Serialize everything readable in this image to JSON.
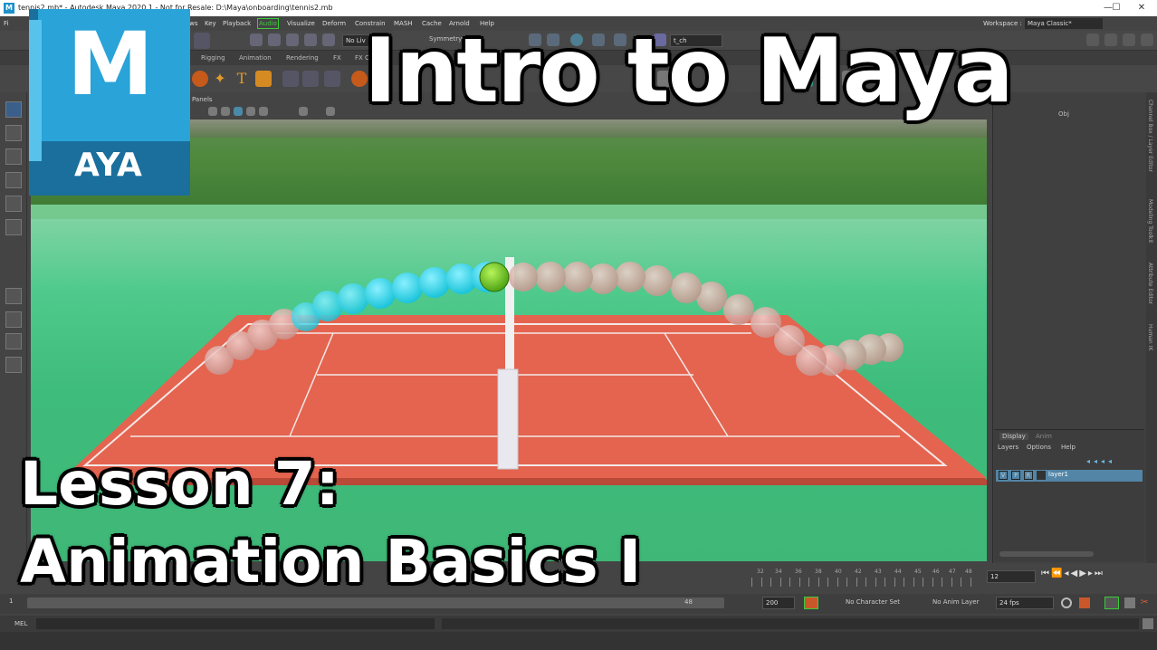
{
  "window": {
    "title": "tennis2.mb* - Autodesk Maya 2020.1 - Not for Resale: D:\\Maya\\onboarding\\tennis2.mb",
    "workspace_label": "Workspace :",
    "workspace_value": "Maya Classic*"
  },
  "menubar": {
    "items": [
      "Fi",
      "ndows",
      "Key",
      "Playback",
      "Audio",
      "Visualize",
      "Deform",
      "Constrain",
      "MASH",
      "Cache",
      "Arnold",
      "Help"
    ]
  },
  "statusline": {
    "no_live": "No Liv",
    "symmetry": "Symmetry: Off",
    "camera_field": "t_ch"
  },
  "shelf": {
    "tabs": [
      "Rigging",
      "Animation",
      "Rendering",
      "FX",
      "FX C"
    ]
  },
  "panel_toolbar": {
    "panels_label": "Panels"
  },
  "right_panel": {
    "obj_label": "Obj",
    "side_tabs": [
      "Channel Box / Layer Editor",
      "Modeling Toolkit",
      "Attribute Editor",
      "Human IK"
    ]
  },
  "layer_editor": {
    "tabs": [
      "Display",
      "Anim"
    ],
    "menus": [
      "Layers",
      "Options",
      "Help"
    ],
    "layer_row": {
      "v": "V",
      "p": "P",
      "r": "R",
      "name": "layer1"
    }
  },
  "timeline": {
    "ticks": [
      "32",
      "34",
      "36",
      "38",
      "40",
      "42",
      "43",
      "44",
      "45",
      "46",
      "47",
      "48"
    ],
    "current_frame": "12"
  },
  "range_bar": {
    "start_frame": "1",
    "range_end": "48",
    "end_frame": "200",
    "character_set": "No Character Set",
    "anim_layer": "No Anim Layer",
    "fps": "24 fps"
  },
  "command_line": {
    "label": "MEL"
  },
  "logo": {
    "letter": "M",
    "subtext": "AYA",
    "color": "#1d91c9"
  },
  "overlay": {
    "title": "Intro to Maya",
    "lesson": "Lesson 7:",
    "subtitle": "Animation Basics I"
  },
  "colors": {
    "court": "#e4644f",
    "grass": "#3fbc7a",
    "ball_trail_cyan": "#2fd6e8",
    "ball_trail_ghost": "#d8a4a0",
    "tennis_ball": "#7bd321"
  }
}
